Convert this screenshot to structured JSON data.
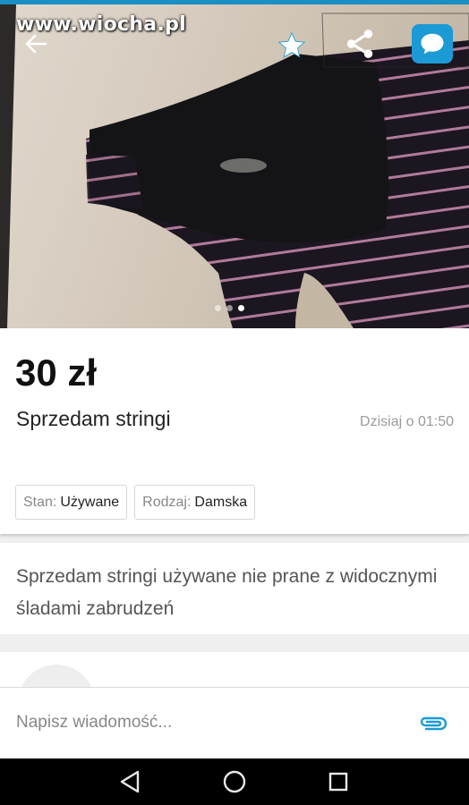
{
  "watermark": "www.wiocha.pl",
  "toolbar": {
    "back_icon": "arrow-left-icon",
    "favorite_icon": "star-icon",
    "share_icon": "share-icon",
    "chat_icon": "chat-bubble-icon"
  },
  "gallery": {
    "total_images": 3,
    "active_index": 2
  },
  "listing": {
    "price": "30 zł",
    "title": "Sprzedam stringi",
    "date": "Dzisiaj o 01:50",
    "params": [
      {
        "key": "Stan:",
        "value": "Używane"
      },
      {
        "key": "Rodzaj:",
        "value": "Damska"
      }
    ],
    "description": "Sprzedam stringi używane nie prane z widocznymi śladami zabrudzeń"
  },
  "message": {
    "placeholder": "Napisz wiadomość...",
    "attach_icon": "paperclip-icon"
  },
  "system_nav": {
    "back_icon": "triangle-back-icon",
    "home_icon": "circle-home-icon",
    "recents_icon": "square-recents-icon"
  },
  "colors": {
    "accent": "#1c9ad6",
    "top_strip": "#1a8fc4",
    "background": "#efefef"
  }
}
